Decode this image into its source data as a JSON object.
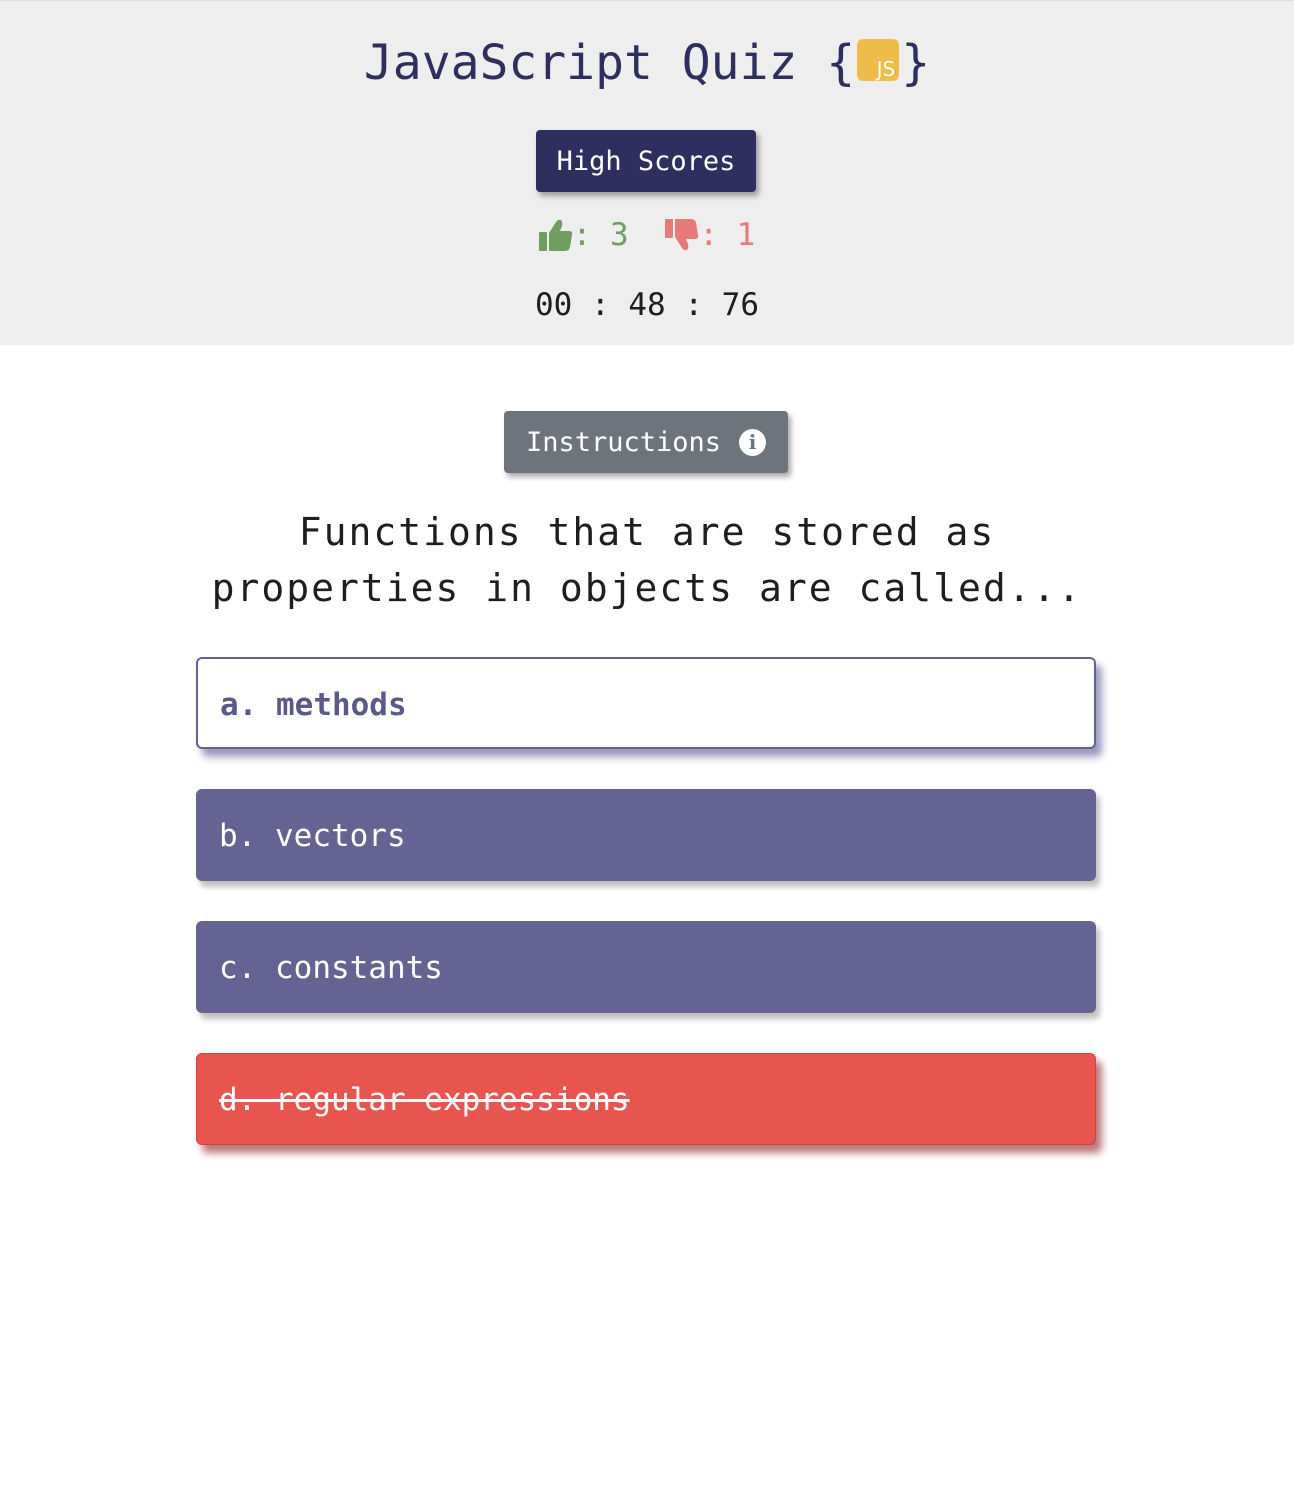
{
  "header": {
    "title": "JavaScript Quiz",
    "brace_open": "{",
    "brace_close": "}",
    "badge_text": "JS",
    "high_scores_label": "High Scores",
    "score": {
      "correct_separator": ": ",
      "correct": "3",
      "wrong_separator": ": ",
      "wrong": "1"
    },
    "timer": "00 : 48 : 76"
  },
  "main": {
    "instructions_label": "Instructions",
    "question": "Functions that are stored as properties in objects are called...",
    "answers": [
      {
        "label": "a. methods",
        "state": "selected"
      },
      {
        "label": "b. vectors",
        "state": "normal"
      },
      {
        "label": "c. constants",
        "state": "normal"
      },
      {
        "label": "d. regular expressions",
        "state": "wrong"
      }
    ]
  },
  "colors": {
    "header_bg": "#eeeeee",
    "primary": "#2e2f5e",
    "answer_bg": "#646391",
    "wrong_bg": "#e8544e",
    "correct_green": "#6f9e60",
    "wrong_red": "#e57a78",
    "instructions_bg": "#6e747b",
    "js_yellow": "#efbc4a"
  },
  "icons": {
    "correct": "thumbs-up-icon",
    "wrong": "thumbs-down-icon",
    "instructions": "info-circle-icon"
  }
}
